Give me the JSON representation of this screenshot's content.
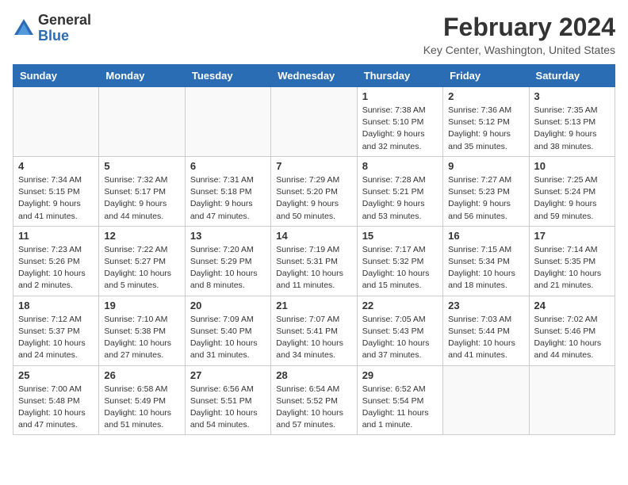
{
  "header": {
    "logo_general": "General",
    "logo_blue": "Blue",
    "month_title": "February 2024",
    "location": "Key Center, Washington, United States"
  },
  "days_of_week": [
    "Sunday",
    "Monday",
    "Tuesday",
    "Wednesday",
    "Thursday",
    "Friday",
    "Saturday"
  ],
  "weeks": [
    [
      {
        "day": "",
        "info": ""
      },
      {
        "day": "",
        "info": ""
      },
      {
        "day": "",
        "info": ""
      },
      {
        "day": "",
        "info": ""
      },
      {
        "day": "1",
        "info": "Sunrise: 7:38 AM\nSunset: 5:10 PM\nDaylight: 9 hours\nand 32 minutes."
      },
      {
        "day": "2",
        "info": "Sunrise: 7:36 AM\nSunset: 5:12 PM\nDaylight: 9 hours\nand 35 minutes."
      },
      {
        "day": "3",
        "info": "Sunrise: 7:35 AM\nSunset: 5:13 PM\nDaylight: 9 hours\nand 38 minutes."
      }
    ],
    [
      {
        "day": "4",
        "info": "Sunrise: 7:34 AM\nSunset: 5:15 PM\nDaylight: 9 hours\nand 41 minutes."
      },
      {
        "day": "5",
        "info": "Sunrise: 7:32 AM\nSunset: 5:17 PM\nDaylight: 9 hours\nand 44 minutes."
      },
      {
        "day": "6",
        "info": "Sunrise: 7:31 AM\nSunset: 5:18 PM\nDaylight: 9 hours\nand 47 minutes."
      },
      {
        "day": "7",
        "info": "Sunrise: 7:29 AM\nSunset: 5:20 PM\nDaylight: 9 hours\nand 50 minutes."
      },
      {
        "day": "8",
        "info": "Sunrise: 7:28 AM\nSunset: 5:21 PM\nDaylight: 9 hours\nand 53 minutes."
      },
      {
        "day": "9",
        "info": "Sunrise: 7:27 AM\nSunset: 5:23 PM\nDaylight: 9 hours\nand 56 minutes."
      },
      {
        "day": "10",
        "info": "Sunrise: 7:25 AM\nSunset: 5:24 PM\nDaylight: 9 hours\nand 59 minutes."
      }
    ],
    [
      {
        "day": "11",
        "info": "Sunrise: 7:23 AM\nSunset: 5:26 PM\nDaylight: 10 hours\nand 2 minutes."
      },
      {
        "day": "12",
        "info": "Sunrise: 7:22 AM\nSunset: 5:27 PM\nDaylight: 10 hours\nand 5 minutes."
      },
      {
        "day": "13",
        "info": "Sunrise: 7:20 AM\nSunset: 5:29 PM\nDaylight: 10 hours\nand 8 minutes."
      },
      {
        "day": "14",
        "info": "Sunrise: 7:19 AM\nSunset: 5:31 PM\nDaylight: 10 hours\nand 11 minutes."
      },
      {
        "day": "15",
        "info": "Sunrise: 7:17 AM\nSunset: 5:32 PM\nDaylight: 10 hours\nand 15 minutes."
      },
      {
        "day": "16",
        "info": "Sunrise: 7:15 AM\nSunset: 5:34 PM\nDaylight: 10 hours\nand 18 minutes."
      },
      {
        "day": "17",
        "info": "Sunrise: 7:14 AM\nSunset: 5:35 PM\nDaylight: 10 hours\nand 21 minutes."
      }
    ],
    [
      {
        "day": "18",
        "info": "Sunrise: 7:12 AM\nSunset: 5:37 PM\nDaylight: 10 hours\nand 24 minutes."
      },
      {
        "day": "19",
        "info": "Sunrise: 7:10 AM\nSunset: 5:38 PM\nDaylight: 10 hours\nand 27 minutes."
      },
      {
        "day": "20",
        "info": "Sunrise: 7:09 AM\nSunset: 5:40 PM\nDaylight: 10 hours\nand 31 minutes."
      },
      {
        "day": "21",
        "info": "Sunrise: 7:07 AM\nSunset: 5:41 PM\nDaylight: 10 hours\nand 34 minutes."
      },
      {
        "day": "22",
        "info": "Sunrise: 7:05 AM\nSunset: 5:43 PM\nDaylight: 10 hours\nand 37 minutes."
      },
      {
        "day": "23",
        "info": "Sunrise: 7:03 AM\nSunset: 5:44 PM\nDaylight: 10 hours\nand 41 minutes."
      },
      {
        "day": "24",
        "info": "Sunrise: 7:02 AM\nSunset: 5:46 PM\nDaylight: 10 hours\nand 44 minutes."
      }
    ],
    [
      {
        "day": "25",
        "info": "Sunrise: 7:00 AM\nSunset: 5:48 PM\nDaylight: 10 hours\nand 47 minutes."
      },
      {
        "day": "26",
        "info": "Sunrise: 6:58 AM\nSunset: 5:49 PM\nDaylight: 10 hours\nand 51 minutes."
      },
      {
        "day": "27",
        "info": "Sunrise: 6:56 AM\nSunset: 5:51 PM\nDaylight: 10 hours\nand 54 minutes."
      },
      {
        "day": "28",
        "info": "Sunrise: 6:54 AM\nSunset: 5:52 PM\nDaylight: 10 hours\nand 57 minutes."
      },
      {
        "day": "29",
        "info": "Sunrise: 6:52 AM\nSunset: 5:54 PM\nDaylight: 11 hours\nand 1 minute."
      },
      {
        "day": "",
        "info": ""
      },
      {
        "day": "",
        "info": ""
      }
    ]
  ]
}
